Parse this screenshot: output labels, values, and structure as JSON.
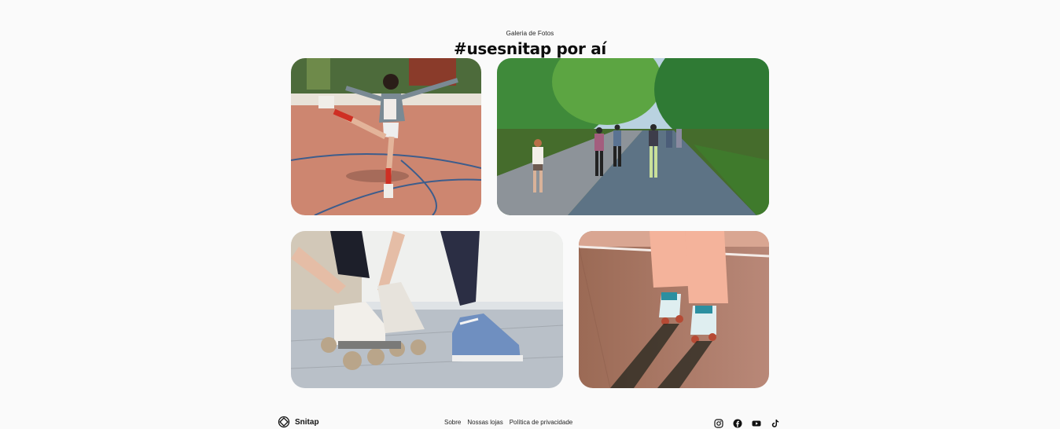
{
  "gallery": {
    "eyebrow": "Galeria de Fotos",
    "title": "#usesnitap por aí",
    "photos": [
      {
        "subject": "skater-balancing-on-court"
      },
      {
        "subject": "group-skating-park-road"
      },
      {
        "subject": "tying-roller-skate-laces"
      },
      {
        "subject": "roller-skates-on-track"
      }
    ]
  },
  "footer": {
    "brand": "Snitap",
    "links": [
      "Sobre",
      "Nossas lojas",
      "Política de privacidade"
    ],
    "social_icons": [
      "instagram-icon",
      "facebook-icon",
      "youtube-icon",
      "tiktok-icon"
    ]
  }
}
